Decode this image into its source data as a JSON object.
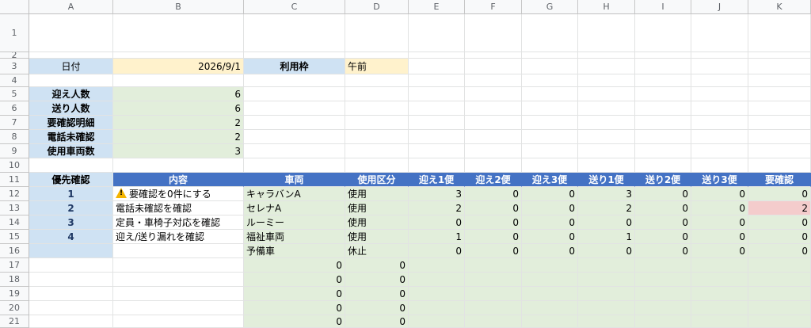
{
  "columns": [
    "A",
    "B",
    "C",
    "D",
    "E",
    "F",
    "G",
    "H",
    "I",
    "J",
    "K"
  ],
  "rows": [
    "1",
    "2",
    "3",
    "4",
    "5",
    "6",
    "7",
    "8",
    "9",
    "10",
    "11",
    "12",
    "13",
    "14",
    "15",
    "16",
    "17",
    "18",
    "19",
    "20",
    "21"
  ],
  "colors": {
    "blue": "#cfe2f3",
    "yellow": "#fff2cc",
    "green": "#e2eedb",
    "header_blue": "#4472c4",
    "alert": "#f4cccc"
  },
  "header": {
    "date_label": "日付",
    "date_value": "2026/9/1",
    "slot_label": "利用枠",
    "slot_value": "午前"
  },
  "summary": [
    {
      "label": "迎え人数",
      "value": "6"
    },
    {
      "label": "送り人数",
      "value": "6"
    },
    {
      "label": "要確認明細",
      "value": "2"
    },
    {
      "label": "電話未確認",
      "value": "2"
    },
    {
      "label": "使用車両数",
      "value": "3"
    }
  ],
  "table": {
    "headers": [
      "優先確認",
      "内容",
      "車両",
      "使用区分",
      "迎え1便",
      "迎え2便",
      "迎え3便",
      "送り1便",
      "送り2便",
      "送り3便",
      "要確認"
    ],
    "priorities": [
      {
        "num": "1",
        "text": "要確認を0件にする",
        "icon": "warning-icon"
      },
      {
        "num": "2",
        "text": "電話未確認を確認"
      },
      {
        "num": "3",
        "text": "定員・車椅子対応を確認"
      },
      {
        "num": "4",
        "text": "迎え/送り漏れを確認"
      }
    ],
    "vehicles": [
      {
        "name": "キャラバンA",
        "status": "使用",
        "values": [
          "3",
          "0",
          "0",
          "3",
          "0",
          "0",
          "0"
        ]
      },
      {
        "name": "セレナA",
        "status": "使用",
        "values": [
          "2",
          "0",
          "0",
          "2",
          "0",
          "0",
          "2"
        ]
      },
      {
        "name": "ルーミー",
        "status": "使用",
        "values": [
          "0",
          "0",
          "0",
          "0",
          "0",
          "0",
          "0"
        ]
      },
      {
        "name": "福祉車両",
        "status": "使用",
        "values": [
          "1",
          "0",
          "0",
          "1",
          "0",
          "0",
          "0"
        ]
      },
      {
        "name": "予備車",
        "status": "休止",
        "values": [
          "0",
          "0",
          "0",
          "0",
          "0",
          "0",
          "0"
        ]
      }
    ]
  },
  "extra_rows": [
    {
      "c": "0",
      "d": "0"
    },
    {
      "c": "0",
      "d": "0"
    },
    {
      "c": "0",
      "d": "0"
    },
    {
      "c": "0",
      "d": "0"
    },
    {
      "c": "0",
      "d": "0"
    }
  ]
}
